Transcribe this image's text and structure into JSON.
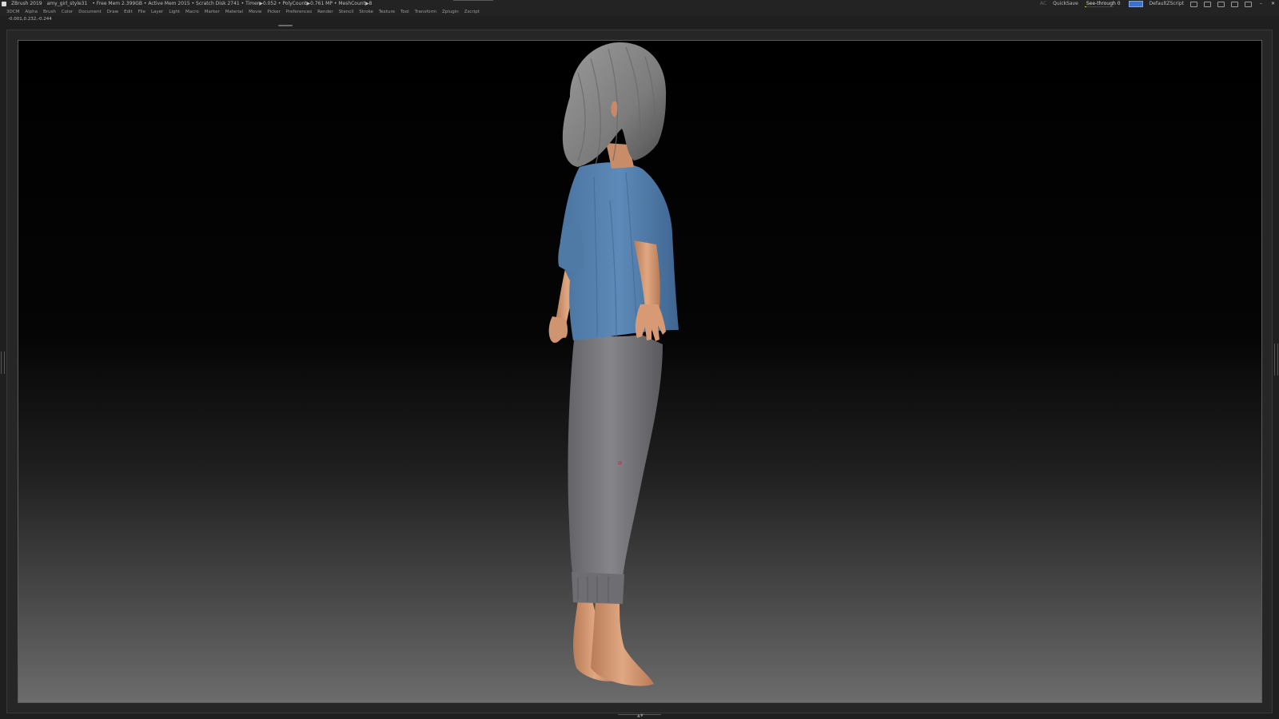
{
  "titlebar": {
    "app_title": "ZBrush 2019",
    "document_name": "amy_girl_style31",
    "stats": "• Free Mem 2.399GB • Active Mem 2015 • Scratch Disk 2741 •  Timer▶0.052 • PolyCount▶0.761 MP  • MeshCount▶8",
    "ac_label": "AC",
    "quicksave_label": "QuickSave",
    "seethrough_label": "See-through",
    "seethrough_value": "0",
    "script_label": "DefaultZScript",
    "minimize": "–",
    "close": "✕"
  },
  "menubar": {
    "items": [
      "3DCM",
      "Alpha",
      "Brush",
      "Color",
      "Document",
      "Draw",
      "Edit",
      "File",
      "Layer",
      "Light",
      "Macro",
      "Marker",
      "Material",
      "Movie",
      "Picker",
      "Preferences",
      "Render",
      "Stencil",
      "Stroke",
      "Texture",
      "Tool",
      "Transform",
      "Zplugin",
      "Zscript"
    ]
  },
  "coords": "-0.001,0.232,-0.244",
  "colors": {
    "shirt": "#5a86b2",
    "pants": "#7a7a7d",
    "skin": "#dca07a",
    "hair": "#8d8d8d",
    "accent": "#3a73c8"
  },
  "icons": {
    "app": "zbrush-logo-icon",
    "menu_toggle": "menu-toggle-icon"
  }
}
